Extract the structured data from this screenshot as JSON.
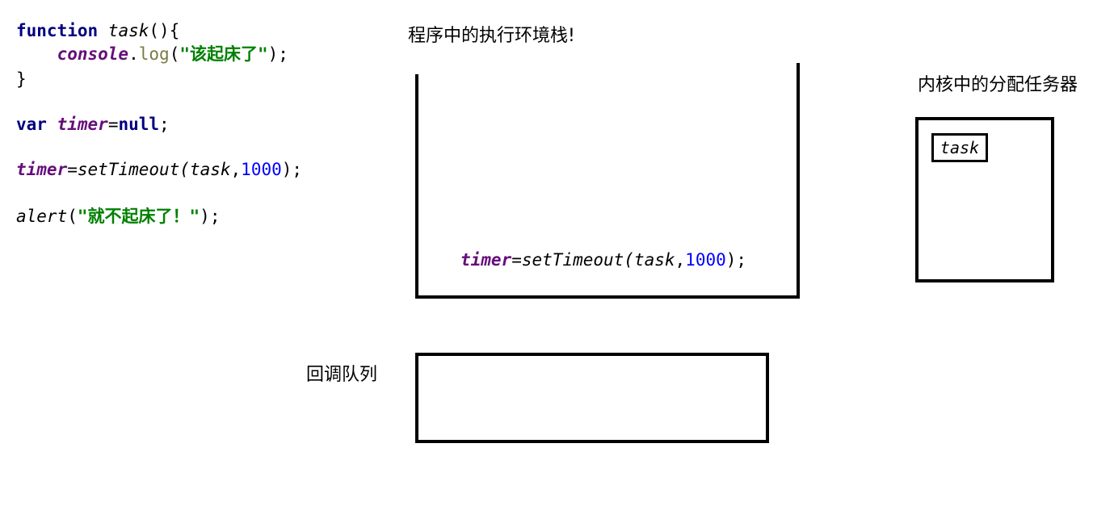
{
  "code": {
    "line1": {
      "kw": "function",
      "name": "task",
      "rest": "(){"
    },
    "line2": {
      "indent": "    ",
      "obj": "console",
      "dot": ".",
      "method": "log",
      "open": "(",
      "str": "\"该起床了\"",
      "close": ");"
    },
    "line3": {
      "text": "}"
    },
    "line4": {
      "kw": "var",
      "var": "timer",
      "eq": "=",
      "null_kw": "null",
      "end": ";"
    },
    "line5": {
      "var": "timer",
      "call": "=setTimeout(",
      "arg": "task",
      "comma": ",",
      "num": "1000",
      "end": ");"
    },
    "line6": {
      "name": "alert",
      "open": "(",
      "str": "\"就不起床了！\"",
      "end": ");"
    }
  },
  "labels": {
    "stack_title": "程序中的执行环境栈!",
    "kernel_title": "内核中的分配任务器",
    "queue_title": "回调队列"
  },
  "stack": {
    "item": {
      "var": "timer",
      "call": "=setTimeout(",
      "arg": "task",
      "comma": ",",
      "num": "1000",
      "end": ");"
    }
  },
  "kernel": {
    "task_label": "task"
  },
  "colors": {
    "keyword": "#000080",
    "variable": "#660e7a",
    "string": "#008000",
    "number": "#0000ff",
    "method": "#7a7a43"
  }
}
